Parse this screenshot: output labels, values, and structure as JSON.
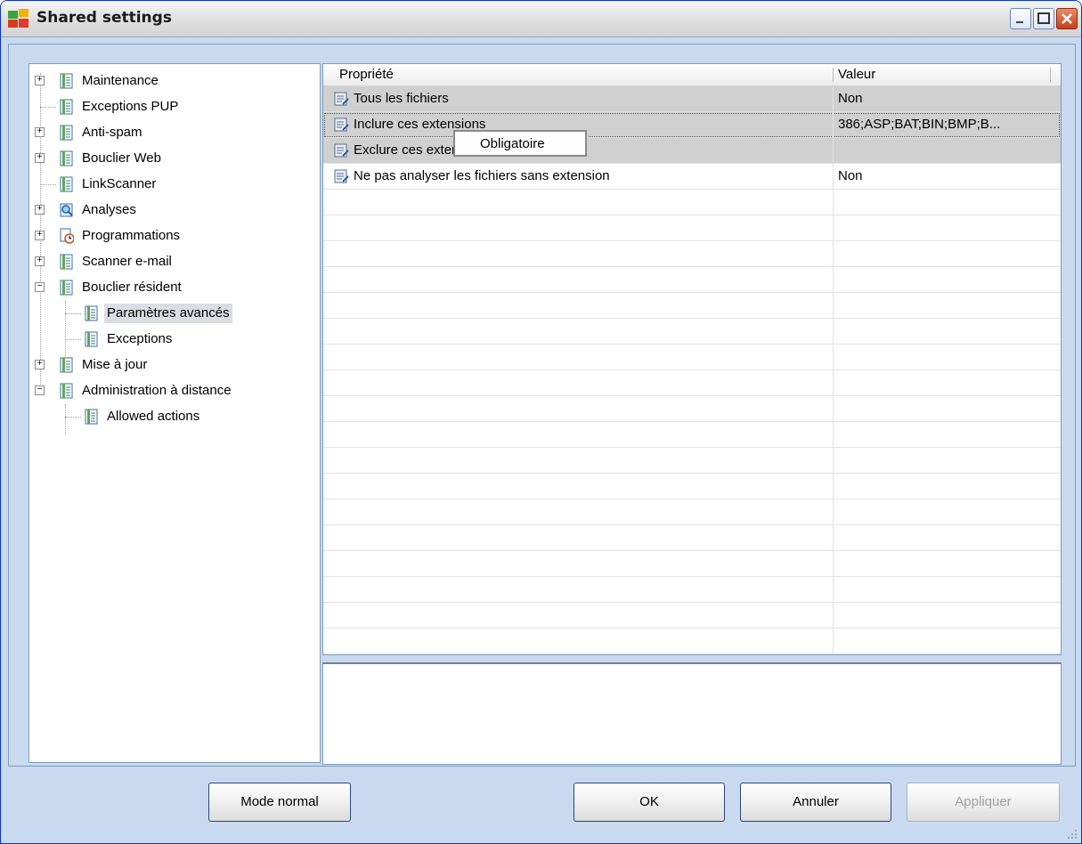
{
  "window": {
    "title": "Shared settings"
  },
  "tree": {
    "items": [
      {
        "label": "Maintenance",
        "expander": "+"
      },
      {
        "label": "Exceptions PUP",
        "expander": ""
      },
      {
        "label": "Anti-spam",
        "expander": "+"
      },
      {
        "label": "Bouclier Web",
        "expander": "+"
      },
      {
        "label": "LinkScanner",
        "expander": ""
      },
      {
        "label": "Analyses",
        "expander": "+"
      },
      {
        "label": "Programmations",
        "expander": "+"
      },
      {
        "label": "Scanner e-mail",
        "expander": "+"
      },
      {
        "label": "Bouclier résident",
        "expander": "−"
      },
      {
        "label": "Paramètres avancés",
        "expander": ""
      },
      {
        "label": "Exceptions",
        "expander": ""
      },
      {
        "label": "Mise à jour",
        "expander": "+"
      },
      {
        "label": "Administration à distance",
        "expander": "−"
      },
      {
        "label": "Allowed actions",
        "expander": ""
      }
    ]
  },
  "grid": {
    "columns": {
      "property": "Propriété",
      "value": "Valeur"
    },
    "rows": [
      {
        "property": "Tous les fichiers",
        "value": "Non"
      },
      {
        "property": "Inclure ces extensions",
        "value": "386;ASP;BAT;BIN;BMP;B..."
      },
      {
        "property": "Exclure ces extensions",
        "value": ""
      },
      {
        "property": "Ne pas analyser les fichiers sans extension",
        "value": "Non"
      }
    ]
  },
  "tooltip": {
    "text": "Obligatoire"
  },
  "buttons": {
    "mode_normal": "Mode normal",
    "ok": "OK",
    "annuler": "Annuler",
    "appliquer": "Appliquer"
  },
  "colors": {
    "title_border": "#0831d9",
    "panel_bg": "#c9daf0",
    "selection": "#d0d0d0"
  }
}
